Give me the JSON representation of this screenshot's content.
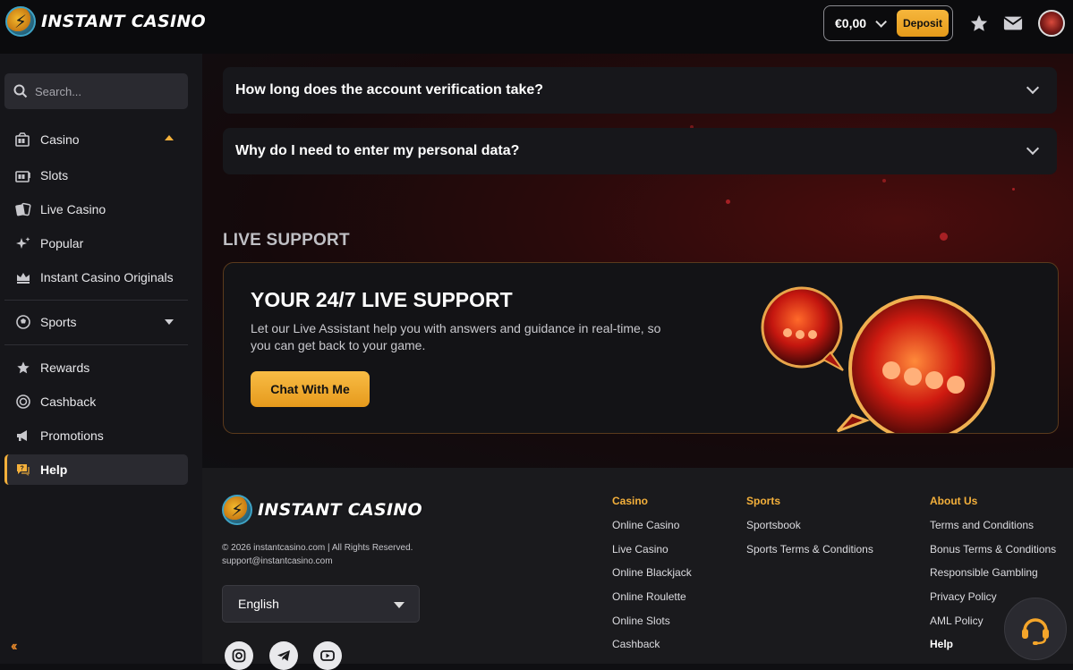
{
  "header": {
    "brand": "INSTANT CASINO",
    "balance": "€0,00",
    "deposit_label": "Deposit",
    "icons": [
      "star-icon",
      "mail-icon",
      "avatar"
    ]
  },
  "sidebar": {
    "search_placeholder": "Search...",
    "items": [
      {
        "label": "Casino",
        "icon": "slot-machine-icon"
      },
      {
        "label": "Slots",
        "icon": "slot-machine-icon"
      },
      {
        "label": "Live Casino",
        "icon": "cards-icon"
      },
      {
        "label": "Popular",
        "icon": "sparkle-icon"
      },
      {
        "label": "Instant Casino Originals",
        "icon": "crown-icon"
      },
      {
        "label": "Sports",
        "icon": "ball-icon"
      },
      {
        "label": "Rewards",
        "icon": "star-icon"
      },
      {
        "label": "Cashback",
        "icon": "coin-icon"
      },
      {
        "label": "Promotions",
        "icon": "megaphone-icon"
      },
      {
        "label": "Help",
        "icon": "help-chat-icon"
      }
    ]
  },
  "faq": [
    {
      "question": "How long does the account verification take?"
    },
    {
      "question": "Why do I need to enter my personal data?"
    }
  ],
  "support": {
    "section_title": "LIVE SUPPORT",
    "title": "YOUR 24/7 LIVE SUPPORT",
    "text": "Let our Live Assistant help you with answers and guidance in real-time, so you can get back to your game.",
    "button_label": "Chat With Me"
  },
  "footer": {
    "brand": "INSTANT CASINO",
    "copyright": "© 2026 instantcasino.com | All Rights Reserved.",
    "email": "support@instantcasino.com",
    "language": "English",
    "columns": [
      {
        "heading": "Casino",
        "links": [
          "Online Casino",
          "Live Casino",
          "Online Blackjack",
          "Online Roulette",
          "Online Slots",
          "Cashback"
        ]
      },
      {
        "heading": "Sports",
        "links": [
          "Sportsbook",
          "Sports Terms & Conditions"
        ]
      },
      {
        "heading": "About Us",
        "links": [
          "Terms and Conditions",
          "Bonus Terms & Conditions",
          "Responsible Gambling",
          "Privacy Policy",
          "AML Policy",
          "Help"
        ]
      }
    ],
    "social": [
      "instagram-icon",
      "telegram-icon",
      "youtube-icon"
    ]
  },
  "colors": {
    "accent": "#f4b03b",
    "background": "#0f0f12",
    "sidebar": "#16161a"
  }
}
